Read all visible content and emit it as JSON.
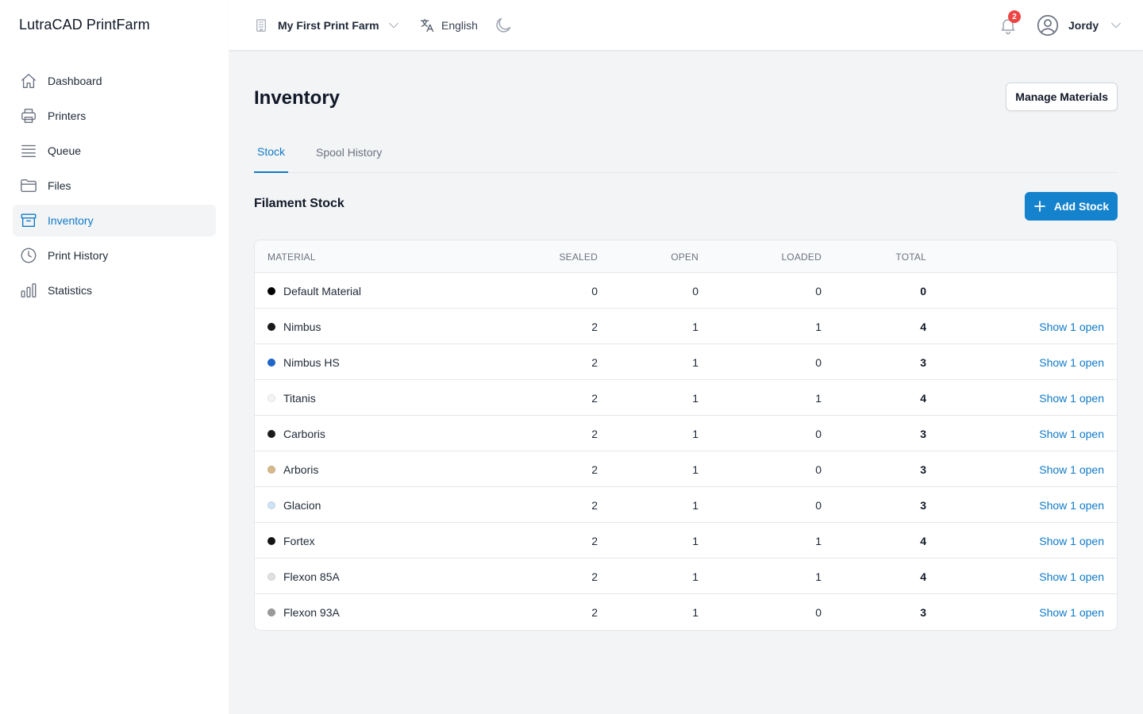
{
  "app": {
    "title": "LutraCAD PrintFarm"
  },
  "sidebar": {
    "items": [
      {
        "label": "Dashboard",
        "icon": "home-icon"
      },
      {
        "label": "Printers",
        "icon": "printer-icon"
      },
      {
        "label": "Queue",
        "icon": "queue-icon"
      },
      {
        "label": "Files",
        "icon": "folder-icon"
      },
      {
        "label": "Inventory",
        "icon": "archive-box-icon",
        "active": true
      },
      {
        "label": "Print History",
        "icon": "clock-icon"
      },
      {
        "label": "Statistics",
        "icon": "bar-chart-icon"
      }
    ]
  },
  "topbar": {
    "farm_name": "My First Print Farm",
    "language": "English",
    "notification_count": "2",
    "user_name": "Jordy"
  },
  "page": {
    "title": "Inventory",
    "manage_materials_label": "Manage Materials",
    "tabs": [
      {
        "label": "Stock",
        "active": true
      },
      {
        "label": "Spool History",
        "active": false
      }
    ],
    "section_title": "Filament Stock",
    "add_stock_label": "Add Stock"
  },
  "table": {
    "headers": {
      "material": "MATERIAL",
      "sealed": "SEALED",
      "open": "OPEN",
      "loaded": "LOADED",
      "total": "TOTAL"
    },
    "rows": [
      {
        "material": "Default Material",
        "color": "#000000",
        "sealed": "0",
        "open": "0",
        "loaded": "0",
        "total": "0",
        "action": ""
      },
      {
        "material": "Nimbus",
        "color": "#1a1a1a",
        "sealed": "2",
        "open": "1",
        "loaded": "1",
        "total": "4",
        "action": "Show 1 open"
      },
      {
        "material": "Nimbus HS",
        "color": "#1f66cc",
        "sealed": "2",
        "open": "1",
        "loaded": "0",
        "total": "3",
        "action": "Show 1 open"
      },
      {
        "material": "Titanis",
        "color": "#f4f4f4",
        "sealed": "2",
        "open": "1",
        "loaded": "1",
        "total": "4",
        "action": "Show 1 open"
      },
      {
        "material": "Carboris",
        "color": "#1c1c1c",
        "sealed": "2",
        "open": "1",
        "loaded": "0",
        "total": "3",
        "action": "Show 1 open"
      },
      {
        "material": "Arboris",
        "color": "#d6b98a",
        "sealed": "2",
        "open": "1",
        "loaded": "0",
        "total": "3",
        "action": "Show 1 open"
      },
      {
        "material": "Glacion",
        "color": "#cfe3f5",
        "sealed": "2",
        "open": "1",
        "loaded": "0",
        "total": "3",
        "action": "Show 1 open"
      },
      {
        "material": "Fortex",
        "color": "#141414",
        "sealed": "2",
        "open": "1",
        "loaded": "1",
        "total": "4",
        "action": "Show 1 open"
      },
      {
        "material": "Flexon 85A",
        "color": "#e0e0e0",
        "sealed": "2",
        "open": "1",
        "loaded": "1",
        "total": "4",
        "action": "Show 1 open"
      },
      {
        "material": "Flexon 93A",
        "color": "#9a9a9a",
        "sealed": "2",
        "open": "1",
        "loaded": "0",
        "total": "3",
        "action": "Show 1 open"
      }
    ]
  },
  "colors": {
    "accent": "#0f7ac7",
    "primary_button": "#1482cc"
  }
}
